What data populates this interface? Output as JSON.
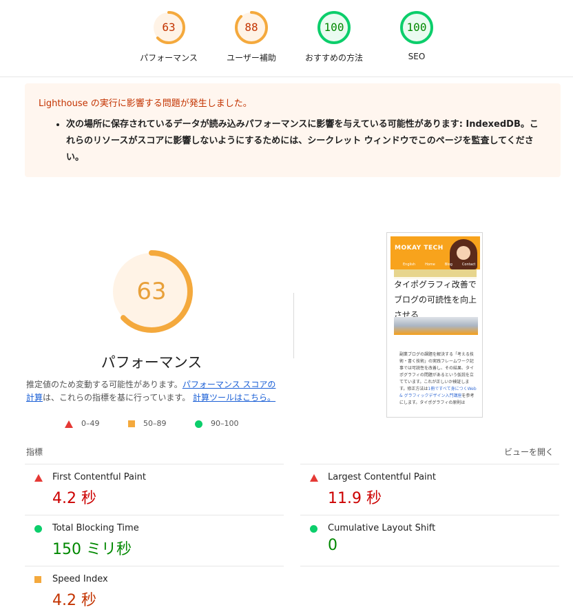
{
  "top_gauges": [
    {
      "score": "63",
      "label": "パフォーマンス",
      "status": "average",
      "color": "#f4a93d",
      "fraction": 0.63
    },
    {
      "score": "88",
      "label": "ユーザー補助",
      "status": "average",
      "color": "#f4a93d",
      "fraction": 0.88
    },
    {
      "score": "100",
      "label": "おすすめの方法",
      "status": "pass",
      "color": "#0cce6b",
      "fraction": 1.0
    },
    {
      "score": "100",
      "label": "SEO",
      "status": "pass",
      "color": "#0cce6b",
      "fraction": 1.0
    }
  ],
  "warning": {
    "title": "Lighthouse の実行に影響する問題が発生しました。",
    "item": "次の場所に保存されているデータが読み込みパフォーマンスに影響を与えている可能性があります: IndexedDB。これらのリソースがスコアに影響しないようにするためには、シークレット ウィンドウでこのページを監査してください。"
  },
  "performance": {
    "score": "63",
    "fraction": 0.63,
    "title": "パフォーマンス",
    "desc_pre": "推定値のため変動する可能性があります。",
    "desc_link1": "パフォーマンス スコアの計算",
    "desc_mid": "は、これらの指標を基に行っています。",
    "desc_link2": "計算ツールはこちら。"
  },
  "legend": [
    {
      "icon": "red-triangle-icon",
      "range": "0–49"
    },
    {
      "icon": "orange-square-icon",
      "range": "50–89"
    },
    {
      "icon": "green-circle-icon",
      "range": "90–100"
    }
  ],
  "thumbnail": {
    "logo": "MOKAY TECH",
    "nav": [
      "English",
      "Home",
      "Blog",
      "Contact"
    ],
    "title": "タイポグラフィ改善でブログの可読性を向上させる",
    "body_pre": "副業ブログの課題を解決する「考える技術・書く技術」の実践フレームワーク記事では可読性を改善し、その結果、タイポグラフィの問題があるという仮説を立てています。これが正しいか検証します。修正方法は",
    "body_link": "1冊ですべて身につくWeb & グラフィックデザイン入門講座",
    "body_post": "を参考にします。タイポグラフィの原則は"
  },
  "metrics": {
    "header": "指標",
    "view_toggle": "ビューを開く",
    "items": [
      {
        "name": "First Contentful Paint",
        "value": "4.2 秒",
        "status": "fail",
        "icon": "red-triangle-icon"
      },
      {
        "name": "Largest Contentful Paint",
        "value": "11.9 秒",
        "status": "fail",
        "icon": "red-triangle-icon"
      },
      {
        "name": "Total Blocking Time",
        "value": "150 ミリ秒",
        "status": "pass",
        "icon": "green-circle-icon"
      },
      {
        "name": "Cumulative Layout Shift",
        "value": "0",
        "status": "pass",
        "icon": "green-circle-icon"
      },
      {
        "name": "Speed Index",
        "value": "4.2 秒",
        "status": "average",
        "icon": "orange-square-icon"
      }
    ]
  },
  "colors": {
    "fail": "#e53935",
    "average": "#f4a93d",
    "pass": "#0cce6b",
    "link": "#1a5fd6"
  }
}
